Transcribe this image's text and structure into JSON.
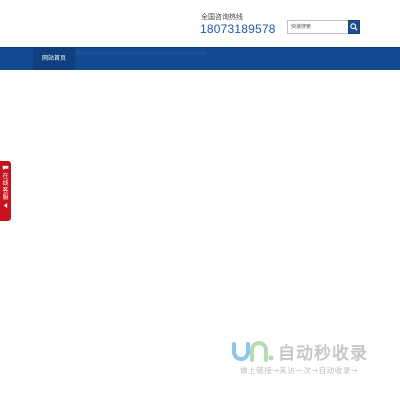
{
  "header": {
    "hotline_label": "全国咨询热线",
    "hotline_number": "18073189578",
    "search": {
      "placeholder": "快速搜索",
      "button_icon": "search-icon"
    }
  },
  "nav": {
    "items": [
      {
        "label": "网站首页"
      }
    ]
  },
  "online_service": {
    "label": "在线客服",
    "icon": "chevron-left-icon"
  },
  "watermark": {
    "brand": "自动秒收录",
    "slogan": "做上链接→来访一次→自动收录→"
  },
  "colors": {
    "nav_bar": "#13498f",
    "service_tab": "#c8131e",
    "hotline": "#1c5aa6"
  }
}
